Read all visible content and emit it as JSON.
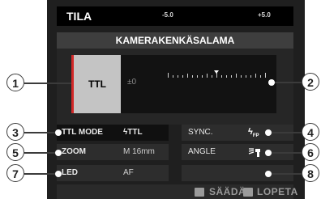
{
  "screen": {
    "title": "TILA",
    "panel_header": "KAMERAKENKÄSALAMA"
  },
  "mode_control": {
    "selected": "TTL",
    "compensation_value": "±0",
    "scale_min_label": "-5.0",
    "scale_max_label": "+5.0",
    "accent_color": "#d22828"
  },
  "settings": {
    "ttl_mode": {
      "label": "TTL MODE",
      "value": "TTL",
      "value_icon": "flash-ttl-icon"
    },
    "sync": {
      "label": "SYNC.",
      "value_icon": "flash-fp-sync-icon",
      "value_badge": "FP"
    },
    "zoom": {
      "label": "ZOOM",
      "value": "M  16mm"
    },
    "angle": {
      "label": "ANGLE",
      "value_icon": "flash-angle-icon"
    },
    "led": {
      "label": "LED",
      "value": "AF"
    },
    "extra": {
      "label": "",
      "value": ""
    }
  },
  "footer": {
    "adjust_label": "SÄÄDÄ",
    "exit_label": "LOPETA"
  },
  "callouts": [
    "1",
    "2",
    "3",
    "4",
    "5",
    "6",
    "7",
    "8"
  ]
}
